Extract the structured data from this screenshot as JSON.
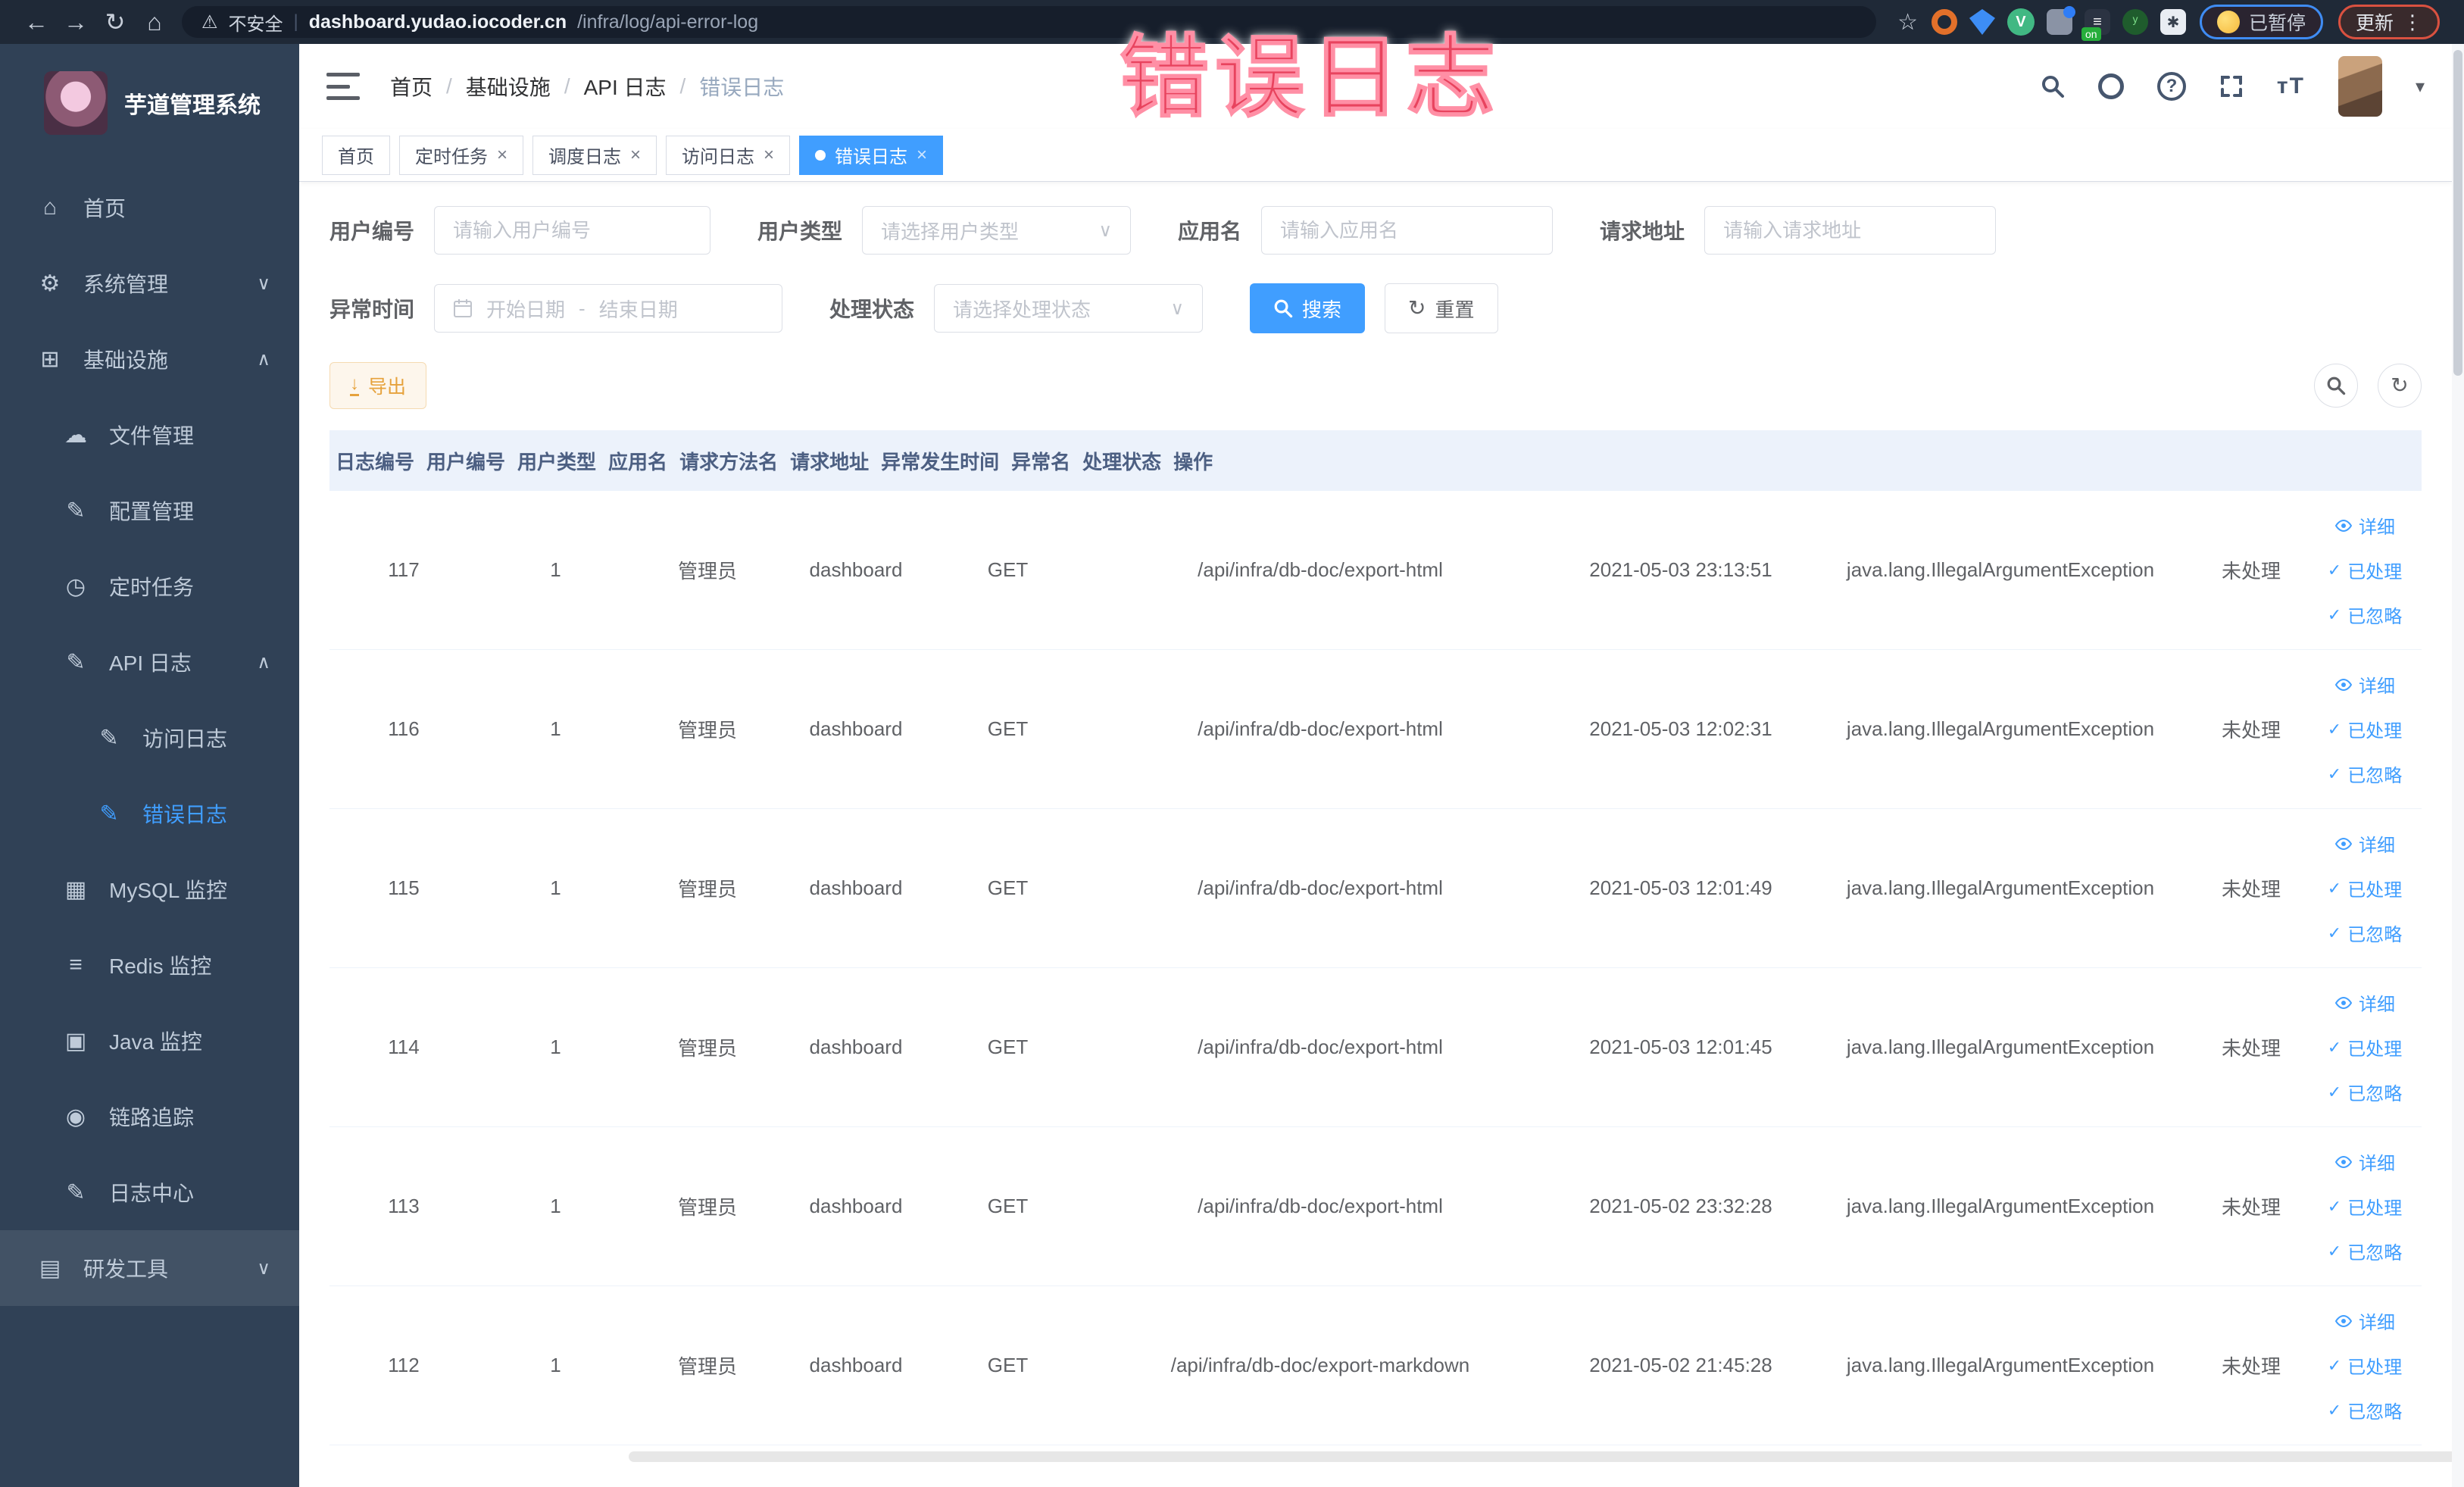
{
  "chrome": {
    "security_text": "不安全",
    "url_domain": "dashboard.yudao.iocoder.cn",
    "url_path": "/infra/log/api-error-log",
    "on_badge": "on",
    "paused_label": "已暂停",
    "update_label": "更新"
  },
  "annotation": {
    "text": "错误日志"
  },
  "sidebar": {
    "title": "芋道管理系统",
    "items": [
      {
        "name": "sidebar-item-home",
        "icon": "dashboard-icon",
        "glyph": "⌂",
        "label": "首页"
      },
      {
        "name": "sidebar-item-system",
        "icon": "gear-icon",
        "glyph": "⚙",
        "label": "系统管理",
        "arrow_glyph": "∨"
      },
      {
        "name": "sidebar-item-infrastructure",
        "icon": "monitor-icon",
        "glyph": "⊞",
        "label": "基础设施",
        "arrow_glyph": "∧"
      },
      {
        "name": "sidebar-item-file-manage",
        "icon": "cloud-upload-icon",
        "glyph": "☁",
        "label": "文件管理",
        "lvl2": true
      },
      {
        "name": "sidebar-item-config-manage",
        "icon": "edit-icon",
        "glyph": "✎",
        "label": "配置管理",
        "lvl2": true
      },
      {
        "name": "sidebar-item-cron-job",
        "icon": "timer-icon",
        "glyph": "◷",
        "label": "定时任务",
        "lvl2": true
      },
      {
        "name": "sidebar-item-api-log",
        "icon": "log-icon",
        "glyph": "✎",
        "label": "API 日志",
        "lvl2": true,
        "arrow_glyph": "∧"
      },
      {
        "name": "sidebar-item-access-log",
        "icon": "log-icon",
        "glyph": "✎",
        "label": "访问日志",
        "lvl3": true
      },
      {
        "name": "sidebar-item-error-log",
        "icon": "log-icon",
        "glyph": "✎",
        "label": "错误日志",
        "lvl3": true,
        "active": true
      },
      {
        "name": "sidebar-item-mysql-monitor",
        "icon": "chart-icon",
        "glyph": "▦",
        "label": "MySQL 监控",
        "lvl2": true
      },
      {
        "name": "sidebar-item-redis-monitor",
        "icon": "layers-icon",
        "glyph": "≡",
        "label": "Redis 监控",
        "lvl2": true
      },
      {
        "name": "sidebar-item-java-monitor",
        "icon": "screen-icon",
        "glyph": "▣",
        "label": "Java 监控",
        "lvl2": true
      },
      {
        "name": "sidebar-item-trace",
        "icon": "eye-icon",
        "glyph": "◉",
        "label": "链路追踪",
        "lvl2": true
      },
      {
        "name": "sidebar-item-log-center",
        "icon": "log-icon",
        "glyph": "✎",
        "label": "日志中心",
        "lvl2": true
      },
      {
        "name": "sidebar-item-devtools",
        "icon": "toolbox-icon",
        "glyph": "▤",
        "label": "研发工具",
        "arrow_glyph": "∨",
        "section": true
      }
    ]
  },
  "header": {
    "breadcrumb": [
      "首页",
      "基础设施",
      "API 日志",
      "错误日志"
    ],
    "separator": "/"
  },
  "tabs": [
    {
      "name": "tab-home",
      "label": "首页"
    },
    {
      "name": "tab-cron-job",
      "label": "定时任务",
      "closable": true,
      "close_glyph": "×"
    },
    {
      "name": "tab-schedule-log",
      "label": "调度日志",
      "closable": true,
      "close_glyph": "×"
    },
    {
      "name": "tab-access-log",
      "label": "访问日志",
      "closable": true,
      "close_glyph": "×"
    },
    {
      "name": "tab-error-log",
      "label": "错误日志",
      "closable": true,
      "close_glyph": "×",
      "active": true
    }
  ],
  "filters": {
    "user_id_label": "用户编号",
    "user_id_placeholder": "请输入用户编号",
    "user_type_label": "用户类型",
    "user_type_placeholder": "请选择用户类型",
    "app_name_label": "应用名",
    "app_name_placeholder": "请输入应用名",
    "request_url_label": "请求地址",
    "request_url_placeholder": "请输入请求地址",
    "time_label": "异常时间",
    "time_start_placeholder": "开始日期",
    "time_separator": "-",
    "time_end_placeholder": "结束日期",
    "status_label": "处理状态",
    "status_placeholder": "请选择处理状态",
    "search_label": "搜索",
    "reset_label": "重置"
  },
  "toolbar": {
    "export_label": "导出"
  },
  "table": {
    "columns": [
      "日志编号",
      "用户编号",
      "用户类型",
      "应用名",
      "请求方法名",
      "请求地址",
      "异常发生时间",
      "异常名",
      "处理状态",
      "操作"
    ],
    "actions": [
      "详细",
      "已处理",
      "已忽略"
    ],
    "rows": [
      {
        "id": "117",
        "user_id": "1",
        "user_type": "管理员",
        "app_name": "dashboard",
        "method": "GET",
        "url": "/api/infra/db-doc/export-html",
        "time": "2021-05-03 23:13:51",
        "exception": "java.lang.IllegalArgumentException",
        "status": "未处理"
      },
      {
        "id": "116",
        "user_id": "1",
        "user_type": "管理员",
        "app_name": "dashboard",
        "method": "GET",
        "url": "/api/infra/db-doc/export-html",
        "time": "2021-05-03 12:02:31",
        "exception": "java.lang.IllegalArgumentException",
        "status": "未处理"
      },
      {
        "id": "115",
        "user_id": "1",
        "user_type": "管理员",
        "app_name": "dashboard",
        "method": "GET",
        "url": "/api/infra/db-doc/export-html",
        "time": "2021-05-03 12:01:49",
        "exception": "java.lang.IllegalArgumentException",
        "status": "未处理"
      },
      {
        "id": "114",
        "user_id": "1",
        "user_type": "管理员",
        "app_name": "dashboard",
        "method": "GET",
        "url": "/api/infra/db-doc/export-html",
        "time": "2021-05-03 12:01:45",
        "exception": "java.lang.IllegalArgumentException",
        "status": "未处理"
      },
      {
        "id": "113",
        "user_id": "1",
        "user_type": "管理员",
        "app_name": "dashboard",
        "method": "GET",
        "url": "/api/infra/db-doc/export-html",
        "time": "2021-05-02 23:32:28",
        "exception": "java.lang.IllegalArgumentException",
        "status": "未处理"
      },
      {
        "id": "112",
        "user_id": "1",
        "user_type": "管理员",
        "app_name": "dashboard",
        "method": "GET",
        "url": "/api/infra/db-doc/export-markdown",
        "time": "2021-05-02 21:45:28",
        "exception": "java.lang.IllegalArgumentException",
        "status": "未处理"
      }
    ]
  }
}
